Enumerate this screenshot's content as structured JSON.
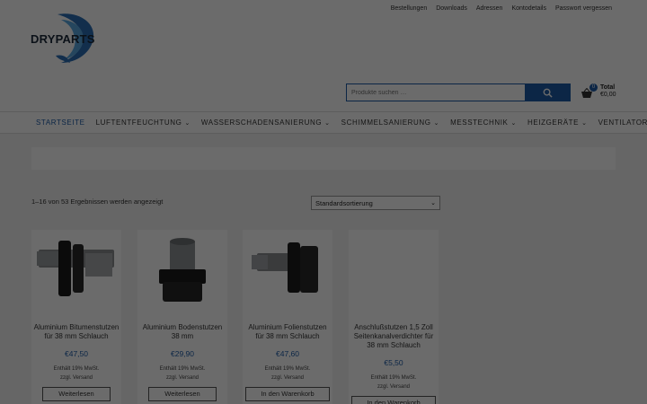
{
  "header": {
    "toplinks": [
      "Bestellungen",
      "Downloads",
      "Adressen",
      "Kontodetails",
      "Passwort vergessen"
    ],
    "logo_text": "DRYPARTS",
    "search_placeholder": "Produkte suchen …",
    "cart": {
      "count": "0",
      "total_label": "Total",
      "total_value": "€0,00"
    }
  },
  "nav": {
    "items": [
      {
        "label": "Startseite",
        "dropdown": false
      },
      {
        "label": "Luftentfeuchtung",
        "dropdown": true
      },
      {
        "label": "Wasserschadensanierung",
        "dropdown": true
      },
      {
        "label": "Schimmelsanierung",
        "dropdown": true
      },
      {
        "label": "Messtechnik",
        "dropdown": true
      },
      {
        "label": "Heizgeräte",
        "dropdown": true
      },
      {
        "label": "Ventilatoren",
        "dropdown": true
      }
    ]
  },
  "shop": {
    "result_count": "1–16 von 53 Ergebnissen werden angezeigt",
    "sort_selected": "Standardsortierung",
    "products": [
      {
        "title": "Aluminium Bitumenstutzen für 38 mm Schlauch",
        "price": "€47,50",
        "tax": "Enthält 19% MwSt.",
        "shipping": "zzgl. Versand",
        "button": "Weiterlesen"
      },
      {
        "title": "Aluminium Bodenstutzen 38 mm",
        "price": "€29,90",
        "tax": "Enthält 19% MwSt.",
        "shipping": "zzgl. Versand",
        "button": "Weiterlesen"
      },
      {
        "title": "Aluminium Folienstutzen für 38 mm Schlauch",
        "price": "€47,60",
        "tax": "Enthält 19% MwSt.",
        "shipping": "zzgl. Versand",
        "button": "In den Warenkorb"
      },
      {
        "title": "Anschlußstutzen 1,5 Zoll Seitenkanalverdichter für 38 mm Schlauch",
        "price": "€5,50",
        "tax": "Enthält 19% MwSt.",
        "shipping": "zzgl. Versand",
        "button": "In den Warenkorb"
      }
    ]
  },
  "colors": {
    "accent": "#1e5ca8",
    "overlay": "rgba(0,0,0,0.58)"
  }
}
